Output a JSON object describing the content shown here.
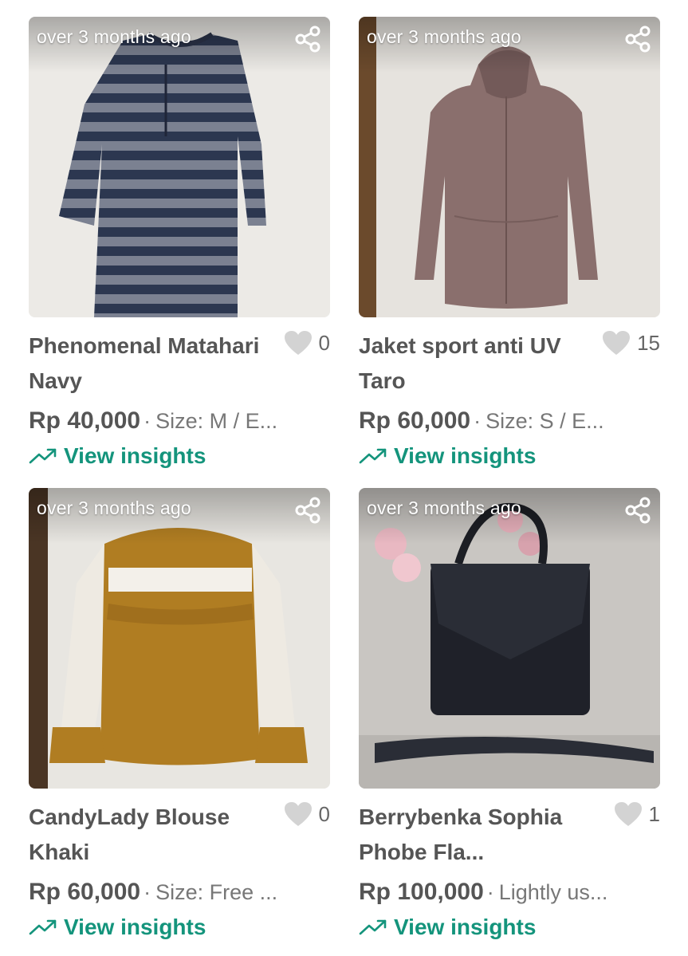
{
  "products": [
    {
      "age": "over 3 months ago",
      "title": "Phenomenal Matahari Navy",
      "likes": "0",
      "price": "Rp 40,000",
      "meta": "Size: M / E...",
      "insights_label": "View insights",
      "photo_subject": "striped navy long-sleeve dress"
    },
    {
      "age": "over 3 months ago",
      "title": "Jaket sport anti UV Taro",
      "likes": "15",
      "price": "Rp 60,000",
      "meta": "Size: S / E...",
      "insights_label": "View insights",
      "photo_subject": "taro hooded zip jacket"
    },
    {
      "age": "over 3 months ago",
      "title": "CandyLady Blouse Khaki",
      "likes": "0",
      "price": "Rp 60,000",
      "meta": "Size: Free ...",
      "insights_label": "View insights",
      "photo_subject": "khaki blouse with white lace sleeves"
    },
    {
      "age": "over 3 months ago",
      "title": "Berrybenka Sophia Phobe Fla...",
      "likes": "1",
      "price": "Rp 100,000",
      "meta": "Lightly us...",
      "insights_label": "View insights",
      "photo_subject": "black croc-embossed handbag"
    }
  ],
  "colors": {
    "accent": "#14947c",
    "text": "#555555",
    "muted": "#777777",
    "heart": "#d3d3d3"
  },
  "icons": {
    "share": "share-icon",
    "like": "heart-icon",
    "trend": "trending-up-icon"
  }
}
